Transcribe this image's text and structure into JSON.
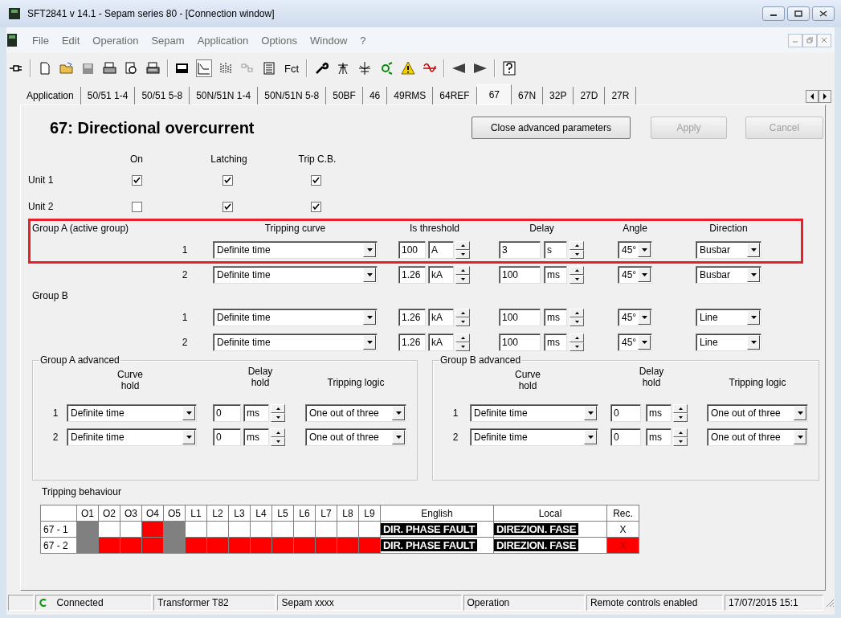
{
  "window": {
    "title": "SFT2841  v 14.1 - Sepam series 80 - [Connection window]"
  },
  "menu": [
    "File",
    "Edit",
    "Operation",
    "Sepam",
    "Application",
    "Options",
    "Window",
    "?"
  ],
  "toolbar": {
    "text_button": "Fct"
  },
  "tabs": [
    {
      "label": "Application",
      "selected": false
    },
    {
      "label": "50/51 1-4",
      "selected": false
    },
    {
      "label": "50/51 5-8",
      "selected": false
    },
    {
      "label": "50N/51N 1-4",
      "selected": false
    },
    {
      "label": "50N/51N 5-8",
      "selected": false
    },
    {
      "label": "50BF",
      "selected": false
    },
    {
      "label": "46",
      "selected": false
    },
    {
      "label": "49RMS",
      "selected": false
    },
    {
      "label": "64REF",
      "selected": false
    },
    {
      "label": "67",
      "selected": true
    },
    {
      "label": "67N",
      "selected": false
    },
    {
      "label": "32P",
      "selected": false
    },
    {
      "label": "27D",
      "selected": false
    },
    {
      "label": "27R",
      "selected": false
    }
  ],
  "panel": {
    "title": "67: Directional overcurrent",
    "buttons": [
      {
        "label": "Close advanced parameters",
        "disabled": false
      },
      {
        "label": "Apply",
        "disabled": true
      },
      {
        "label": "Cancel",
        "disabled": true
      }
    ]
  },
  "units": {
    "columns": [
      "On",
      "Latching",
      "Trip C.B."
    ],
    "rows": [
      {
        "label": "Unit 1",
        "checks": [
          {
            "checked": true
          },
          {
            "checked": true
          },
          {
            "checked": true
          }
        ]
      },
      {
        "label": "Unit 2",
        "checks": [
          {
            "checked": false
          },
          {
            "checked": true
          },
          {
            "checked": true
          }
        ]
      }
    ]
  },
  "groups": {
    "items": [
      {
        "label": "Group A  (active group)",
        "highlighted": true,
        "columns": [
          "Tripping curve",
          "Is threshold",
          "Delay",
          "Angle",
          "Direction"
        ],
        "rows": [
          {
            "number": "1",
            "curve": "Definite time",
            "threshold": "100",
            "threshold_unit": "A",
            "delay": "3",
            "delay_unit": "s",
            "angle": "45°",
            "direction": "Busbar"
          },
          {
            "number": "2",
            "curve": "Definite time",
            "threshold": "1.26",
            "threshold_unit": "kA",
            "delay": "100",
            "delay_unit": "ms",
            "angle": "45°",
            "direction": "Busbar"
          }
        ]
      },
      {
        "label": "Group B",
        "highlighted": false,
        "rows": [
          {
            "number": "1",
            "curve": "Definite time",
            "threshold": "1.26",
            "threshold_unit": "kA",
            "delay": "100",
            "delay_unit": "ms",
            "angle": "45°",
            "direction": "Line"
          },
          {
            "number": "2",
            "curve": "Definite time",
            "threshold": "1.26",
            "threshold_unit": "kA",
            "delay": "100",
            "delay_unit": "ms",
            "angle": "45°",
            "direction": "Line"
          }
        ]
      }
    ]
  },
  "advanced": [
    {
      "title": "Group A advanced",
      "columns": [
        "Curve hold",
        "Delay hold",
        "Tripping logic"
      ],
      "rows": [
        {
          "number": "1",
          "curve_hold": "Definite time",
          "delay_hold": "0",
          "unit": "ms",
          "logic": "One out of three"
        },
        {
          "number": "2",
          "curve_hold": "Definite time",
          "delay_hold": "0",
          "unit": "ms",
          "logic": "One out of three"
        }
      ]
    },
    {
      "title": "Group B advanced",
      "columns": [
        "Curve hold",
        "Delay hold",
        "Tripping logic"
      ],
      "rows": [
        {
          "number": "1",
          "curve_hold": "Definite time",
          "delay_hold": "0",
          "unit": "ms",
          "logic": "One out of three"
        },
        {
          "number": "2",
          "curve_hold": "Definite time",
          "delay_hold": "0",
          "unit": "ms",
          "logic": "One out of three"
        }
      ]
    }
  ],
  "tripping_behaviour": {
    "title": "Tripping behaviour",
    "columns": [
      "O1",
      "O2",
      "O3",
      "O4",
      "O5",
      "L1",
      "L2",
      "L3",
      "L4",
      "L5",
      "L6",
      "L7",
      "L8",
      "L9",
      "English",
      "Local",
      "Rec."
    ],
    "rows": [
      {
        "label": "67 - 1",
        "cells": [
          {
            "color": "#808080"
          },
          {
            "color": "#ffffff"
          },
          {
            "color": "#ffffff"
          },
          {
            "color": "#ff0000"
          },
          {
            "color": "#808080"
          },
          {
            "color": "#ffffff"
          },
          {
            "color": "#ffffff"
          },
          {
            "color": "#ffffff"
          },
          {
            "color": "#ffffff"
          },
          {
            "color": "#ffffff"
          },
          {
            "color": "#ffffff"
          },
          {
            "color": "#ffffff"
          },
          {
            "color": "#ffffff"
          },
          {
            "color": "#ffffff"
          }
        ],
        "english": "DIR. PHASE FAULT",
        "local": "DIREZION. FASE",
        "rec": {
          "text": "X",
          "color": "#ffffff"
        }
      },
      {
        "label": "67 - 2",
        "cells": [
          {
            "color": "#808080"
          },
          {
            "color": "#ff0000"
          },
          {
            "color": "#ff0000"
          },
          {
            "color": "#ff0000"
          },
          {
            "color": "#808080"
          },
          {
            "color": "#ff0000"
          },
          {
            "color": "#ff0000"
          },
          {
            "color": "#ff0000"
          },
          {
            "color": "#ff0000"
          },
          {
            "color": "#ff0000"
          },
          {
            "color": "#ff0000"
          },
          {
            "color": "#ff0000"
          },
          {
            "color": "#ff0000"
          },
          {
            "color": "#ff0000"
          }
        ],
        "english": "DIR. PHASE FAULT",
        "local": "DIREZION. FASE",
        "rec": {
          "text": "X",
          "color": "#ff0000"
        }
      }
    ]
  },
  "status_bar": [
    "Connected",
    "Transformer T82",
    "Sepam xxxx",
    "Operation",
    "Remote controls enabled",
    "17/07/2015 15:1"
  ]
}
